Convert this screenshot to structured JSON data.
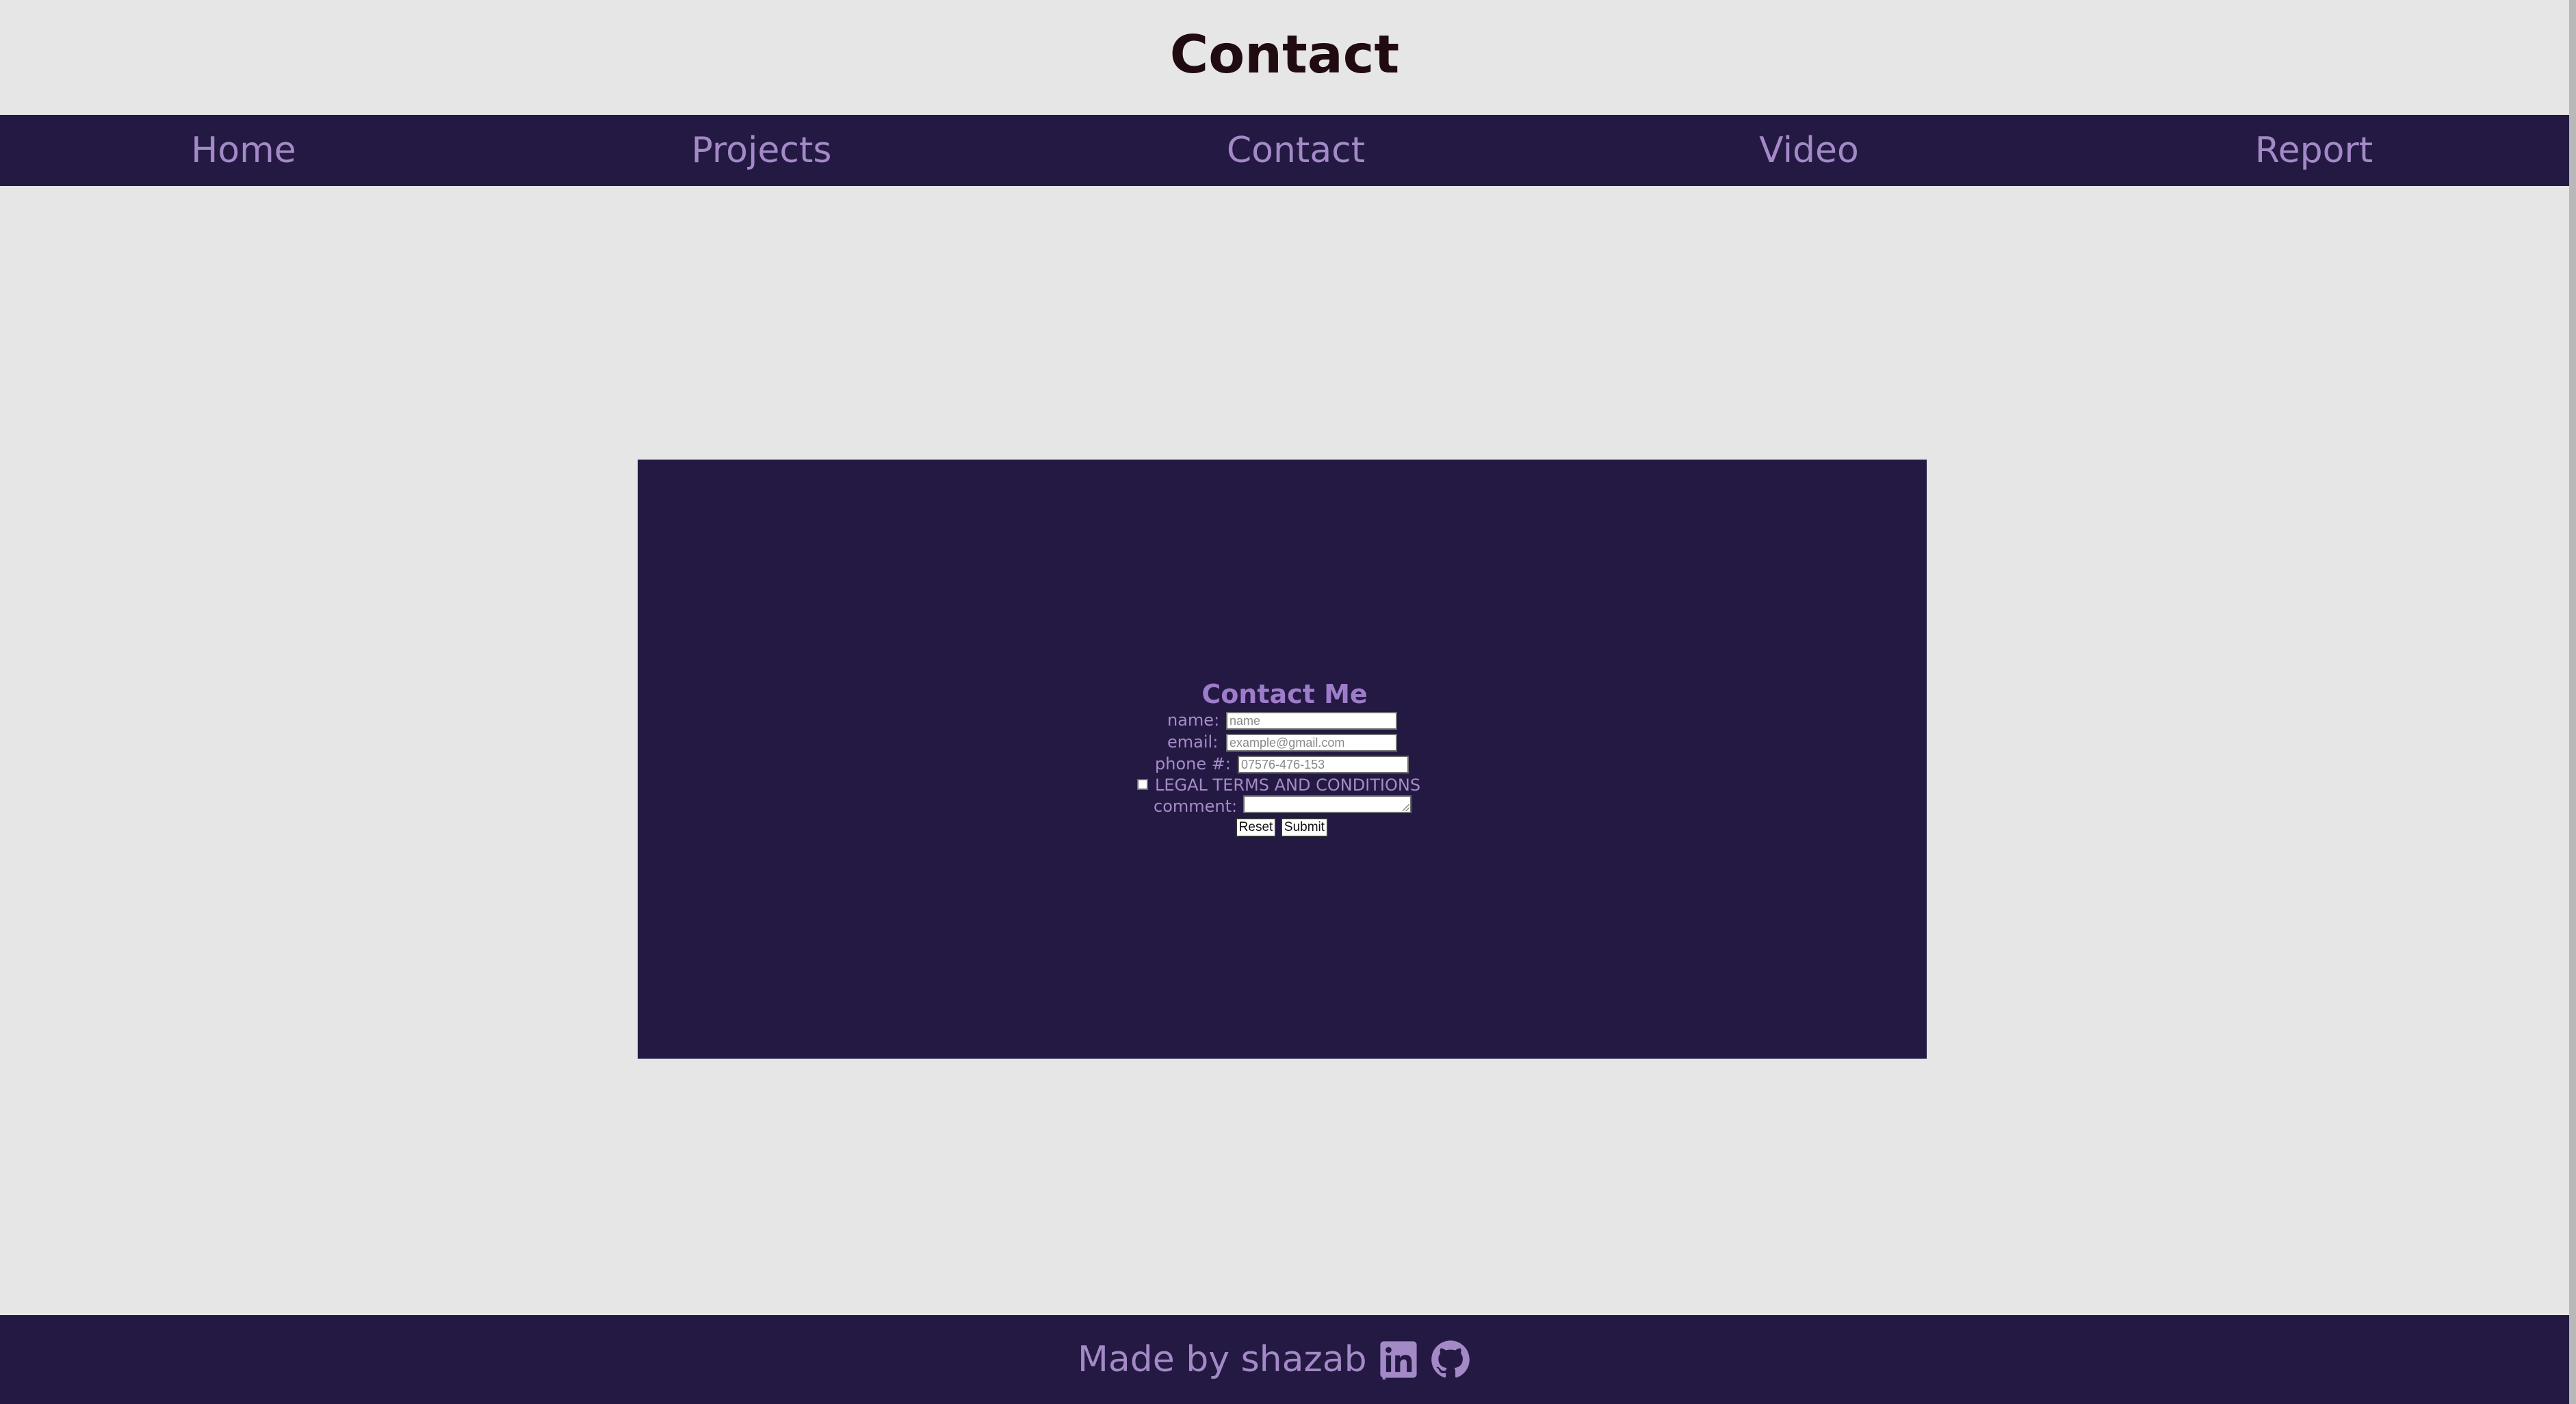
{
  "header": {
    "title": "Contact"
  },
  "nav": {
    "items": [
      {
        "label": "Home"
      },
      {
        "label": "Projects"
      },
      {
        "label": "Contact"
      },
      {
        "label": "Video"
      },
      {
        "label": "Report"
      }
    ]
  },
  "contact_form": {
    "title": "Contact Me",
    "name_label": "name:",
    "name_placeholder": "name",
    "email_label": "email:",
    "email_placeholder": "example@gmail.com",
    "phone_label": "phone #:",
    "phone_placeholder": "07576-476-153",
    "terms_label": "LEGAL TERMS AND CONDITIONS",
    "comment_label": "comment:",
    "reset_label": "Reset",
    "submit_label": "Submit"
  },
  "footer": {
    "text": "Made by shazab |",
    "icons": [
      "linkedin-icon",
      "github-icon"
    ]
  },
  "colors": {
    "background": "#e6e6e6",
    "dark_purple": "#241943",
    "accent_lavender": "#a389c6",
    "title_text": "#1f0b10"
  }
}
